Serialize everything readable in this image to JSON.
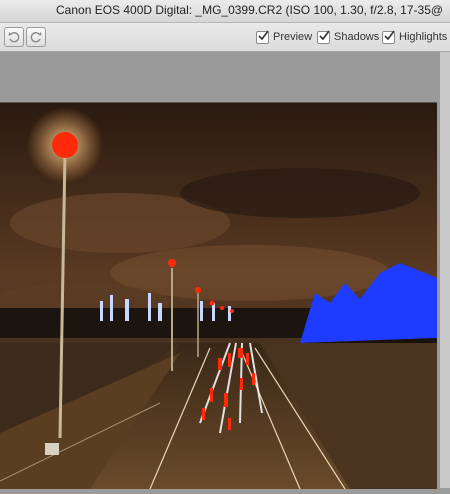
{
  "window": {
    "title": "Canon EOS 400D Digital:  _MG_0399.CR2  (ISO 100, 1.30, f/2.8, 17-35@"
  },
  "toolbar": {
    "rotate_left_icon": "rotate-ccw-icon",
    "rotate_right_icon": "rotate-cw-icon",
    "options": [
      {
        "label": "Preview",
        "checked": true
      },
      {
        "label": "Shadows",
        "checked": true
      },
      {
        "label": "Highlights",
        "checked": true
      }
    ]
  },
  "colors": {
    "shadow_clip": "#1e3cff",
    "highlight_clip": "#ff2a0a"
  }
}
